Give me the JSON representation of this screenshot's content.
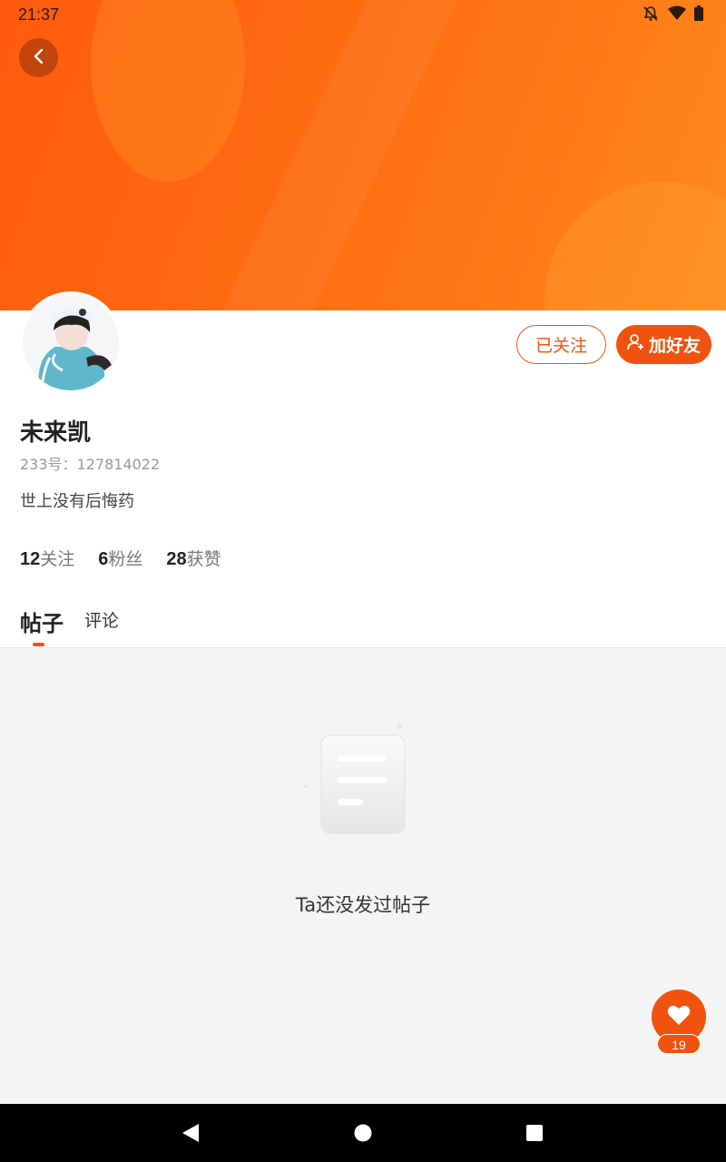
{
  "status_bar": {
    "time": "21:37",
    "icons": [
      "bell-off-icon",
      "wifi-icon",
      "battery-icon"
    ]
  },
  "header": {
    "back_icon": "chevron-left-icon"
  },
  "profile": {
    "name": "未来凯",
    "id_label": "233号：127814022",
    "bio": "世上没有后悔药",
    "follow_label": "已关注",
    "add_friend_label": "加好友",
    "add_friend_icon": "add-user-icon"
  },
  "stats": [
    {
      "value": "12",
      "label": "关注"
    },
    {
      "value": "6",
      "label": "粉丝"
    },
    {
      "value": "28",
      "label": "获赞"
    }
  ],
  "tabs": [
    {
      "label": "帖子",
      "active": true
    },
    {
      "label": "评论",
      "active": false
    }
  ],
  "empty_state": {
    "icon": "document-icon",
    "message": "Ta还没发过帖子"
  },
  "like_button": {
    "icon": "heart-icon",
    "count": "19"
  },
  "nav_bar": {
    "icons": [
      "back-triangle-icon",
      "home-circle-icon",
      "recents-square-icon"
    ]
  },
  "colors": {
    "accent": "#f0520f",
    "banner_start": "#ff5a0e",
    "banner_end": "#ff8a1c"
  }
}
